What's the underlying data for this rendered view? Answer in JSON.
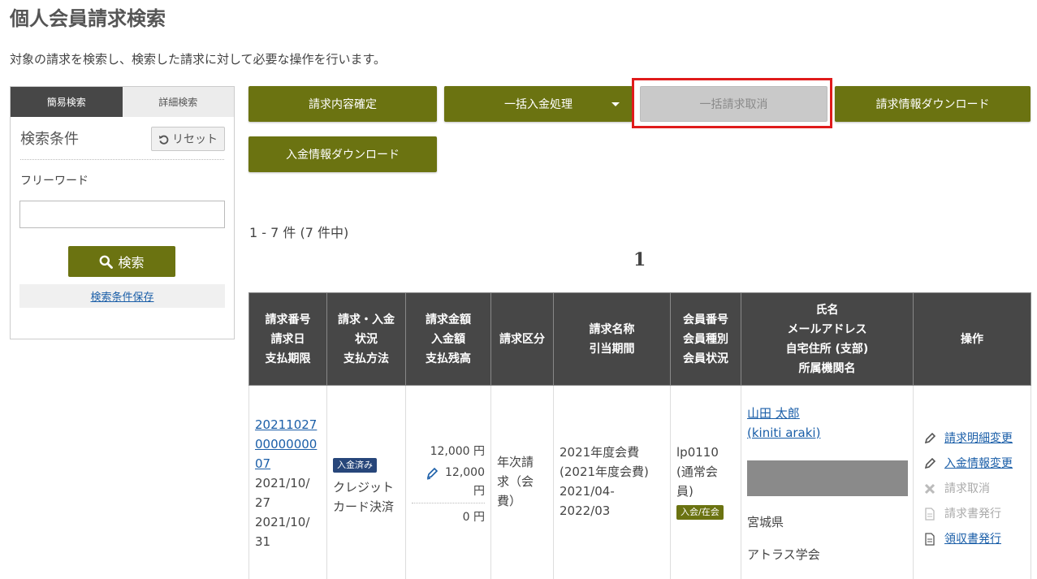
{
  "page": {
    "title": "個人会員請求検索",
    "description": "対象の請求を検索し、検索した請求に対して必要な操作を行います。"
  },
  "sidebar": {
    "tabs": [
      {
        "label": "簡易検索",
        "active": true
      },
      {
        "label": "詳細検索",
        "active": false
      }
    ],
    "condition_title": "検索条件",
    "reset_label": "リセット",
    "freeword_label": "フリーワード",
    "freeword_value": "",
    "search_label": "検索",
    "save_condition_label": "検索条件保存"
  },
  "actions": {
    "confirm_label": "請求内容確定",
    "bulk_payment_label": "一括入金処理",
    "bulk_cancel_label": "一括請求取消",
    "invoice_download_label": "請求情報ダウンロード",
    "payment_download_label": "入金情報ダウンロード"
  },
  "results": {
    "count_text": "1 - 7 件 (7 件中)",
    "page": "1"
  },
  "table": {
    "headers": {
      "col1": [
        "請求番号",
        "請求日",
        "支払期限"
      ],
      "col2": [
        "請求・入金",
        "状況",
        "支払方法"
      ],
      "col3": [
        "請求金額",
        "入金額",
        "支払残高"
      ],
      "col4": [
        "請求区分"
      ],
      "col5": [
        "請求名称",
        "引当期間"
      ],
      "col6": [
        "会員番号",
        "会員種別",
        "会員状況"
      ],
      "col7": [
        "氏名",
        "メールアドレス",
        "自宅住所 (支部)",
        "所属機関名"
      ],
      "col8": [
        "操作"
      ]
    },
    "row": {
      "invoice_no_lines": [
        "20211027",
        "00000000",
        "07"
      ],
      "invoice_date_lines": [
        "2021/10/",
        "27"
      ],
      "due_date_lines": [
        "2021/10/",
        "31"
      ],
      "status_badge": "入金済み",
      "payment_method_lines": [
        "クレジット",
        "カード決済"
      ],
      "billed_amount": "12,000 円",
      "paid_amount_lines": [
        "12,000",
        "円"
      ],
      "balance": "0 円",
      "category_lines": [
        "年次請",
        "求（会",
        "費）"
      ],
      "name_lines": [
        "2021年度会費",
        "(2021年度会費)",
        "2021/04-",
        "2022/03"
      ],
      "member_lines": [
        "lp0110",
        "(通常会",
        "員)"
      ],
      "member_status_badge": "入会/在会",
      "person_name": "山田 太郎",
      "person_name_kana": "(kiniti araki)",
      "prefecture": "宮城県",
      "affiliation": "アトラス学会",
      "operations": [
        {
          "label": "請求明細変更",
          "icon": "pencil-icon",
          "enabled": true
        },
        {
          "label": "入金情報変更",
          "icon": "pencil-icon",
          "enabled": true
        },
        {
          "label": "請求取消",
          "icon": "cross-icon",
          "enabled": false
        },
        {
          "label": "請求書発行",
          "icon": "document-icon",
          "enabled": false
        },
        {
          "label": "領収書発行",
          "icon": "document-icon",
          "enabled": true
        }
      ]
    }
  },
  "colors": {
    "olive_button": "#6b7311",
    "header_dark": "#474747",
    "link_blue": "#1a5ea8",
    "highlight_red": "#e01b1b",
    "badge_blue": "#27467a"
  }
}
